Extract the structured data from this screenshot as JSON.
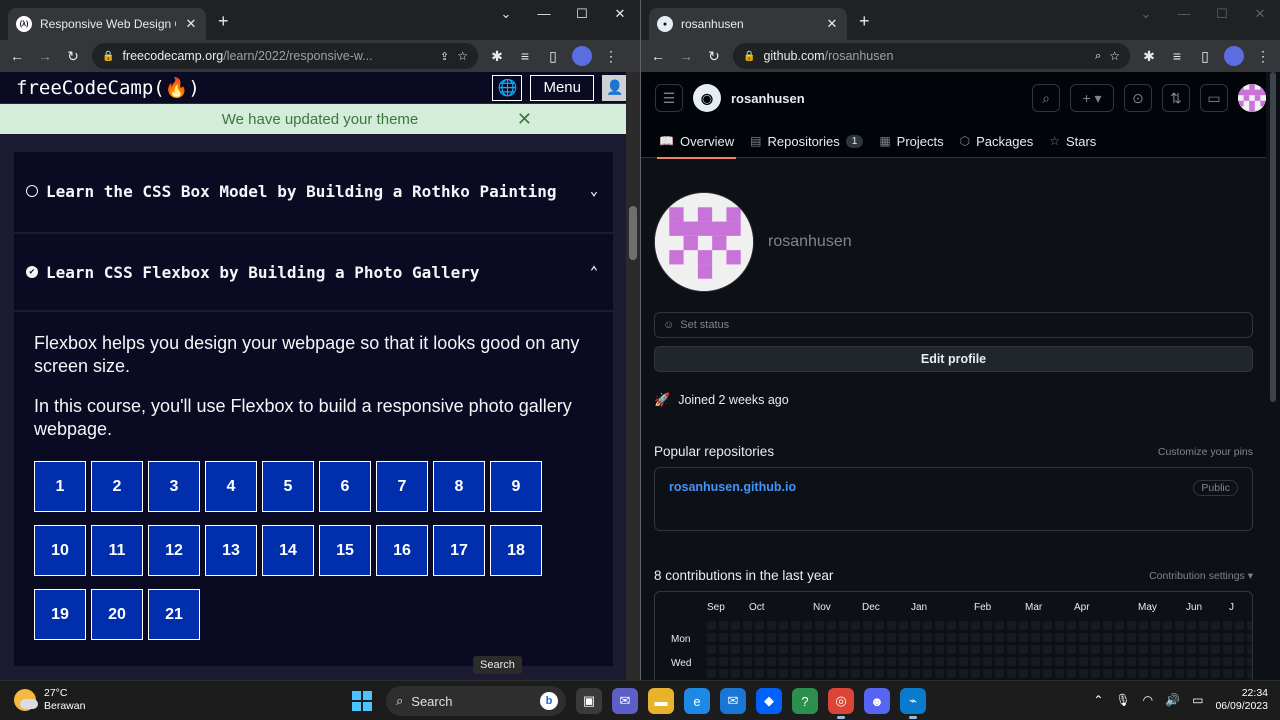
{
  "left_browser": {
    "tab_title": "Responsive Web Design Certificati",
    "tab_favicon": "(λ)",
    "url_domain": "freecodecamp.org",
    "url_path": "/learn/2022/responsive-w..."
  },
  "right_browser": {
    "tab_title": "rosanhusen",
    "url_domain": "github.com",
    "url_path": "/rosanhusen"
  },
  "fcc": {
    "logo": "freeCodeCamp(🔥)",
    "menu_label": "Menu",
    "banner": "We have updated your theme",
    "blocks": [
      {
        "title": "Learn the CSS Box Model by Building a Rothko Painting",
        "completed": false,
        "expanded": false
      },
      {
        "title": "Learn CSS Flexbox by Building a Photo Gallery",
        "completed": true,
        "expanded": true
      }
    ],
    "description": [
      "Flexbox helps you design your webpage so that it looks good on any screen size.",
      "In this course, you'll use Flexbox to build a responsive photo gallery webpage."
    ],
    "steps": [
      "1",
      "2",
      "3",
      "4",
      "5",
      "6",
      "7",
      "8",
      "9",
      "10",
      "11",
      "12",
      "13",
      "14",
      "15",
      "16",
      "17",
      "18",
      "19",
      "20",
      "21"
    ],
    "tooltip": "Search"
  },
  "github": {
    "username": "rosanhusen",
    "tabs": [
      {
        "label": "Overview",
        "icon": "book-icon",
        "active": true
      },
      {
        "label": "Repositories",
        "icon": "repo-icon",
        "count": "1"
      },
      {
        "label": "Projects",
        "icon": "table-icon"
      },
      {
        "label": "Packages",
        "icon": "package-icon"
      },
      {
        "label": "Stars",
        "icon": "star-icon"
      }
    ],
    "login": "rosanhusen",
    "status_placeholder": "Set status",
    "edit_profile": "Edit profile",
    "joined": "Joined 2 weeks ago",
    "popular_title": "Popular repositories",
    "customize_pins": "Customize your pins",
    "repo_name": "rosanhusen.github.io",
    "repo_badge": "Public",
    "contrib_title": "8 contributions in the last year",
    "contrib_settings": "Contribution settings ▾",
    "months": [
      "Sep",
      "Oct",
      "Nov",
      "Dec",
      "Jan",
      "Feb",
      "Mar",
      "Apr",
      "May",
      "Jun",
      "J"
    ],
    "days": [
      "Mon",
      "Wed"
    ]
  },
  "taskbar": {
    "temp": "27°C",
    "weather": "Berawan",
    "search": "Search",
    "time": "22:34",
    "date": "06/09/2023"
  }
}
